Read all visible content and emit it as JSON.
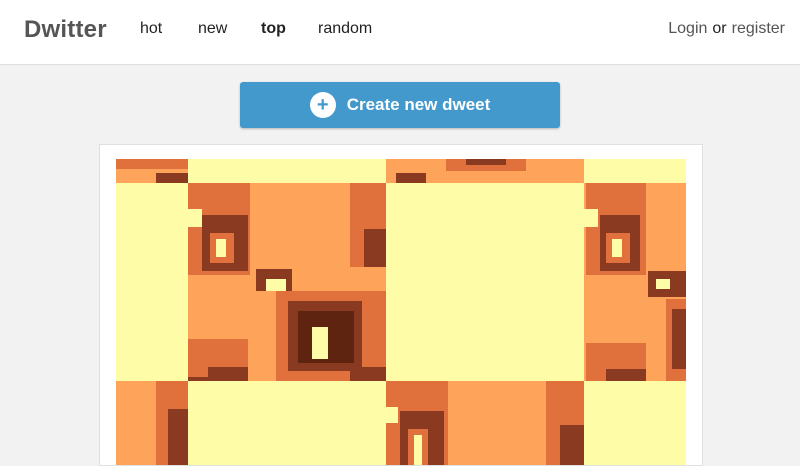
{
  "header": {
    "brand": "Dwitter",
    "nav": [
      {
        "label": "hot",
        "active": false
      },
      {
        "label": "new",
        "active": false
      },
      {
        "label": "top",
        "active": true
      },
      {
        "label": "random",
        "active": false
      }
    ],
    "auth": {
      "login": "Login",
      "or": "or",
      "register": "register"
    }
  },
  "create_button": {
    "icon": "plus-icon",
    "label": "Create new dweet"
  },
  "dweet": {
    "canvas": "dweet-canvas"
  },
  "colors": {
    "page_bg": "#f2f2f2",
    "button_blue": "#4499cc",
    "cream": "#fffca8",
    "orange": "#fda45a",
    "dark_orange": "#e0703c",
    "brown": "#8a3a20"
  }
}
